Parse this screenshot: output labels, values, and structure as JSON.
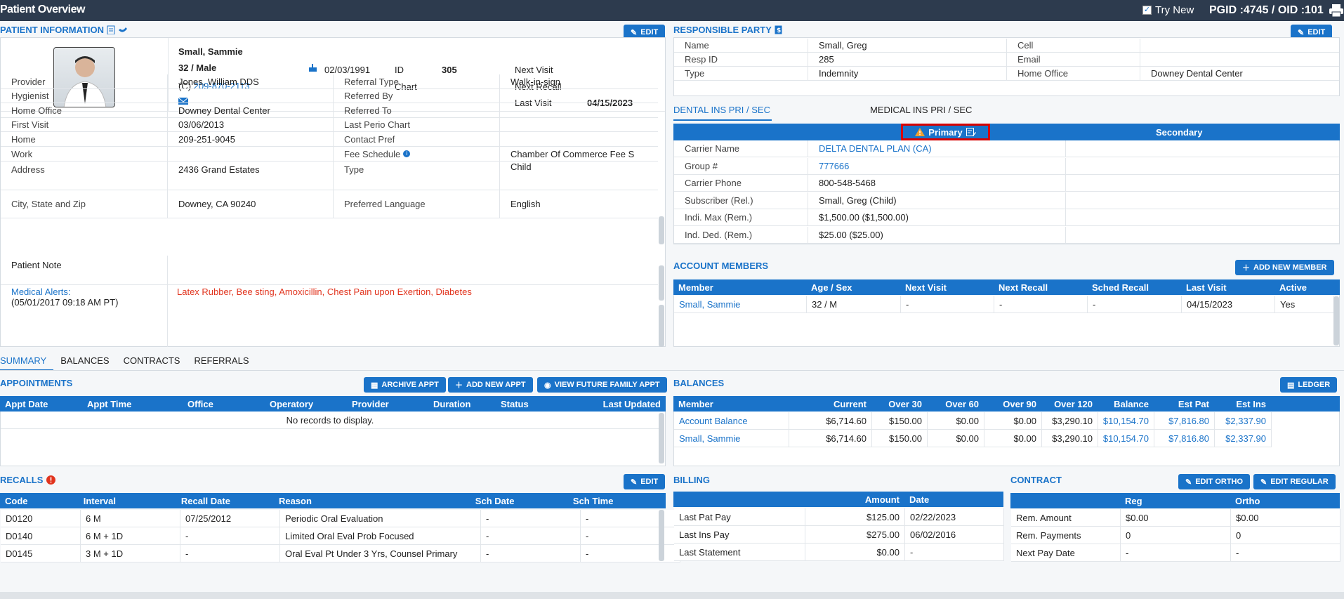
{
  "topbar": {
    "title": "Patient Overview",
    "try_new": "Try New",
    "pgid": "PGID :4745  /  OID :101"
  },
  "patient_info": {
    "title": "PATIENT INFORMATION",
    "edit": "EDIT",
    "name": "Small, Sammie",
    "age_sex": "32 / Male",
    "phone_prefix": "(C)",
    "phone": "209-870-2113",
    "dob": "02/03/1991",
    "id_label": "ID",
    "id": "305",
    "chart_label": "Chart",
    "next_visit_label": "Next Visit",
    "next_recall_label": "Next Recall",
    "last_visit_label": "Last Visit",
    "last_visit": "04/15/2023",
    "rows": [
      {
        "l1": "Provider",
        "v1": "Jones, William DDS",
        "l2": "Referral Type",
        "v2": "Walk-in-sign"
      },
      {
        "l1": "Hygienist",
        "v1": "",
        "l2": "Referred By",
        "v2": ""
      },
      {
        "l1": "Home Office",
        "v1": "Downey Dental Center",
        "l2": "Referred To",
        "v2": ""
      },
      {
        "l1": "First Visit",
        "v1": "03/06/2013",
        "l2": "Last Perio Chart",
        "v2": ""
      },
      {
        "l1": "Home",
        "v1": "209-251-9045",
        "l2": "Contact Pref",
        "v2": ""
      },
      {
        "l1": "Work",
        "v1": "",
        "l2": "Fee Schedule",
        "v2": "Chamber Of Commerce Fee S"
      },
      {
        "l1": "Address",
        "v1": "2436 Grand Estates",
        "l2": "Type",
        "v2": "Child"
      },
      {
        "l1": "City, State and Zip",
        "v1": "Downey, CA 90240",
        "l2": "Preferred Language",
        "v2": "English"
      }
    ],
    "patient_note_label": "Patient Note",
    "medical_alerts_label": "Medical Alerts:",
    "medical_alerts_date": "(05/01/2017 09:18 AM PT)",
    "medical_alerts": "Latex Rubber, Bee sting, Amoxicillin, Chest Pain upon Exertion, Diabetes"
  },
  "responsible_party": {
    "title": "RESPONSIBLE PARTY",
    "edit": "EDIT",
    "rows": [
      {
        "l1": "Name",
        "v1": "Small, Greg",
        "l2": "Cell",
        "v2": ""
      },
      {
        "l1": "Resp ID",
        "v1": "285",
        "l2": "Email",
        "v2": ""
      },
      {
        "l1": "Type",
        "v1": "Indemnity",
        "l2": "Home Office",
        "v2": "Downey Dental Center"
      }
    ]
  },
  "insurance": {
    "tab_dental": "DENTAL INS PRI / SEC",
    "tab_medical": "MEDICAL INS PRI / SEC",
    "primary": "Primary",
    "secondary": "Secondary",
    "rows": [
      {
        "l": "Carrier Name",
        "v": "DELTA DENTAL PLAN (CA)",
        "link": true
      },
      {
        "l": "Group #",
        "v": "777666",
        "link": true
      },
      {
        "l": "Carrier Phone",
        "v": "800-548-5468",
        "link": false
      },
      {
        "l": "Subscriber (Rel.)",
        "v": "Small, Greg (Child)",
        "link": false
      },
      {
        "l": "Indi. Max (Rem.)",
        "v": "$1,500.00 ($1,500.00)",
        "link": false
      },
      {
        "l": "Ind. Ded. (Rem.)",
        "v": "$25.00 ($25.00)",
        "link": false
      }
    ]
  },
  "account_members": {
    "title": "ACCOUNT MEMBERS",
    "add": "ADD NEW MEMBER",
    "headers": [
      "Member",
      "Age / Sex",
      "Next Visit",
      "Next Recall",
      "Sched Recall",
      "Last Visit",
      "Active"
    ],
    "rows": [
      [
        "Small, Sammie",
        "32 / M",
        "-",
        "-",
        "-",
        "04/15/2023",
        "Yes"
      ]
    ]
  },
  "tabs": [
    "SUMMARY",
    "BALANCES",
    "CONTRACTS",
    "REFERRALS"
  ],
  "appointments": {
    "title": "APPOINTMENTS",
    "archive": "ARCHIVE APPT",
    "add": "ADD NEW APPT",
    "future": "VIEW FUTURE FAMILY APPT",
    "headers": [
      "Appt Date",
      "Appt Time",
      "Office",
      "Operatory",
      "Provider",
      "Duration",
      "Status",
      "Last Updated"
    ],
    "empty": "No records to display."
  },
  "balances": {
    "title": "BALANCES",
    "ledger": "LEDGER",
    "headers": [
      "Member",
      "Current",
      "Over 30",
      "Over 60",
      "Over 90",
      "Over 120",
      "Balance",
      "Est Pat",
      "Est Ins"
    ],
    "rows": [
      [
        "Account Balance",
        "$6,714.60",
        "$150.00",
        "$0.00",
        "$0.00",
        "$3,290.10",
        "$10,154.70",
        "$7,816.80",
        "$2,337.90"
      ],
      [
        "Small, Sammie",
        "$6,714.60",
        "$150.00",
        "$0.00",
        "$0.00",
        "$3,290.10",
        "$10,154.70",
        "$7,816.80",
        "$2,337.90"
      ]
    ]
  },
  "recalls": {
    "title": "RECALLS",
    "edit": "EDIT",
    "headers": [
      "Code",
      "Interval",
      "Recall Date",
      "Reason",
      "Sch Date",
      "Sch Time"
    ],
    "rows": [
      [
        "D0120",
        "6 M",
        "07/25/2012",
        "Periodic Oral Evaluation",
        "-",
        "-"
      ],
      [
        "D0140",
        "6 M + 1D",
        "-",
        "Limited Oral Eval Prob Focused",
        "-",
        "-"
      ],
      [
        "D0145",
        "3 M + 1D",
        "-",
        "Oral Eval Pt Under 3 Yrs, Counsel Primary",
        "-",
        "-"
      ]
    ]
  },
  "billing": {
    "title": "BILLING",
    "headers": [
      "",
      "Amount",
      "Date"
    ],
    "rows": [
      [
        "Last Pat Pay",
        "$125.00",
        "02/22/2023"
      ],
      [
        "Last Ins Pay",
        "$275.00",
        "06/02/2016"
      ],
      [
        "Last Statement",
        "$0.00",
        "-"
      ]
    ]
  },
  "contract": {
    "title": "CONTRACT",
    "edit_ortho": "EDIT ORTHO",
    "edit_regular": "EDIT REGULAR",
    "headers": [
      "",
      "Reg",
      "Ortho"
    ],
    "rows": [
      [
        "Rem. Amount",
        "$0.00",
        "$0.00"
      ],
      [
        "Rem. Payments",
        "0",
        "0"
      ],
      [
        "Next Pay Date",
        "-",
        "-"
      ]
    ]
  }
}
